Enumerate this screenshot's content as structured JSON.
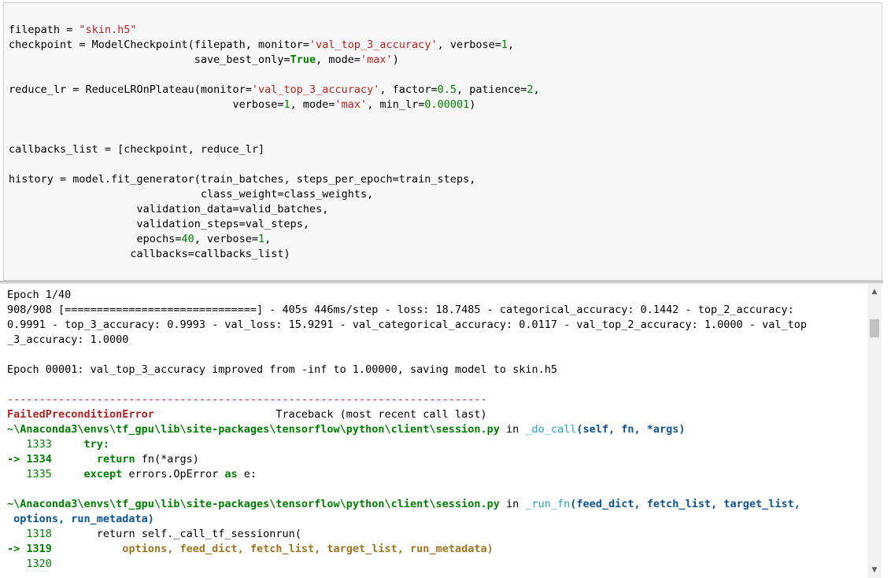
{
  "code_cell": {
    "l01": "filepath = ",
    "l01_str": "\"skin.h5\"",
    "l02a": "checkpoint = ModelCheckpoint(filepath, monitor=",
    "l02_str": "'val_top_3_accuracy'",
    "l02b": ", verbose=",
    "l02_num": "1",
    "l02c": ",",
    "l03a": "                             save_best_only=",
    "l03_kw": "True",
    "l03b": ", mode=",
    "l03_str": "'max'",
    "l03c": ")",
    "l05a": "reduce_lr = ReduceLROnPlateau(monitor=",
    "l05_str": "'val_top_3_accuracy'",
    "l05b": ", factor=",
    "l05_num1": "0.5",
    "l05c": ", patience=",
    "l05_num2": "2",
    "l05d": ",",
    "l06a": "                                   verbose=",
    "l06_num1": "1",
    "l06b": ", mode=",
    "l06_str": "'max'",
    "l06c": ", min_lr=",
    "l06_num2": "0.00001",
    "l06d": ")",
    "l09": "callbacks_list = [checkpoint, reduce_lr]",
    "l11": "history = model.fit_generator(train_batches, steps_per_epoch=train_steps,",
    "l12": "                              class_weight=class_weights,",
    "l13": "                    validation_data=valid_batches,",
    "l14": "                    validation_steps=val_steps,",
    "l15a": "                    epochs=",
    "l15_num": "40",
    "l15b": ", verbose=",
    "l15_num2": "1",
    "l15c": ",",
    "l16": "                   callbacks=callbacks_list)"
  },
  "output": {
    "epoch_header": "Epoch 1/40",
    "progress1": "908/908 [==============================] - 405s 446ms/step - loss: 18.7485 - categorical_accuracy: 0.1442 - top_2_accuracy:",
    "progress2": "0.9991 - top_3_accuracy: 0.9993 - val_loss: 15.9291 - val_categorical_accuracy: 0.0117 - val_top_2_accuracy: 1.0000 - val_top",
    "progress3": "_3_accuracy: 1.0000",
    "checkpoint_msg": "Epoch 00001: val_top_3_accuracy improved from -inf to 1.00000, saving model to skin.h5",
    "dashes": "---------------------------------------------------------------------------",
    "error_name": "FailedPreconditionError",
    "traceback_label": "                   Traceback (most recent call last)",
    "path1": "~\\Anaconda3\\envs\\tf_gpu\\lib\\site-packages\\tensorflow\\python\\client\\session.py",
    "in1": " in ",
    "func1": "_do_call",
    "args1": "(self, fn, *args)",
    "ln1333": "   1333",
    "ln1333_code": "     try:",
    "arrow1": "-> 1334",
    "ln1334_code_a": "       ",
    "ln1334_kw": "return",
    "ln1334_code_b": " fn(*args)",
    "ln1335": "   1335",
    "ln1335_pad": "     ",
    "ln1335_kw1": "except",
    "ln1335_mid": " errors.OpError ",
    "ln1335_kw2": "as",
    "ln1335_end": " e:",
    "path2": "~\\Anaconda3\\envs\\tf_gpu\\lib\\site-packages\\tensorflow\\python\\client\\session.py",
    "in2": " in ",
    "func2": "_run_fn",
    "args2a": "(feed_dict, fetch_list, target_list,",
    "args2b": " options, run_metadata)",
    "ln1318": "   1318",
    "ln1318_code": "       return self._call_tf_sessionrun(",
    "arrow2": "-> 1319",
    "ln1319_code": "           options, feed_dict, fetch_list, target_list, run_metadata)",
    "ln1320": "   1320"
  },
  "scrollbar": {
    "up_icon": "▲",
    "down_icon": "▼"
  }
}
